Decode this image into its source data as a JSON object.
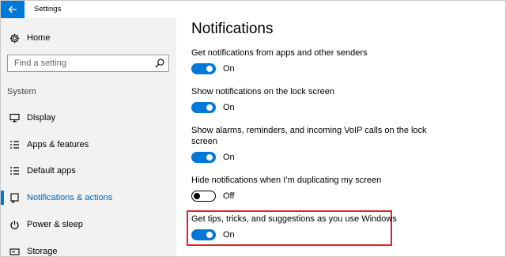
{
  "window": {
    "title": "Settings"
  },
  "sidebar": {
    "home_label": "Home",
    "search": {
      "placeholder": "Find a setting"
    },
    "section_label": "System",
    "items": [
      {
        "label": "Display",
        "icon": "monitor-icon",
        "active": false
      },
      {
        "label": "Apps & features",
        "icon": "list-icon",
        "active": false
      },
      {
        "label": "Default apps",
        "icon": "list-icon",
        "active": false
      },
      {
        "label": "Notifications & actions",
        "icon": "notifications-icon",
        "active": true
      },
      {
        "label": "Power & sleep",
        "icon": "power-icon",
        "active": false
      },
      {
        "label": "Storage",
        "icon": "storage-icon",
        "active": false
      }
    ]
  },
  "main": {
    "title": "Notifications",
    "settings": [
      {
        "label": "Get notifications from apps and other senders",
        "state": "On",
        "on": true
      },
      {
        "label": "Show notifications on the lock screen",
        "state": "On",
        "on": true
      },
      {
        "label": "Show alarms, reminders, and incoming VoIP calls on the lock screen",
        "state": "On",
        "on": true
      },
      {
        "label": "Hide notifications when I’m duplicating my screen",
        "state": "Off",
        "on": false
      },
      {
        "label": "Get tips, tricks, and suggestions as you use Windows",
        "state": "On",
        "on": true
      }
    ]
  },
  "colors": {
    "accent": "#0078d7",
    "highlight": "#e0202a",
    "sidebar_bg": "#f2f2f2"
  }
}
